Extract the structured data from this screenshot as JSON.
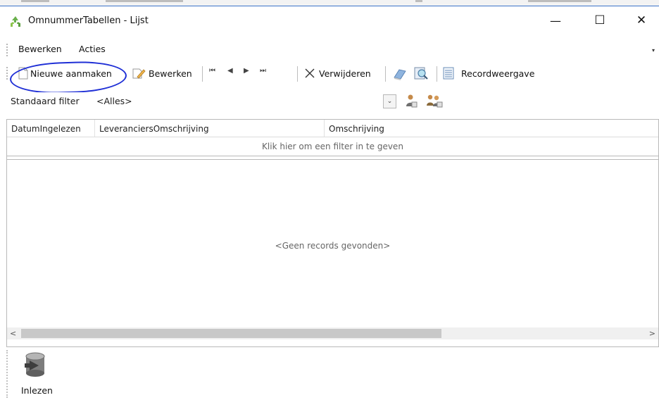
{
  "window": {
    "title": "OmnummerTabellen - Lijst",
    "minimize_glyph": "—",
    "maximize_glyph": "☐",
    "close_glyph": "✕"
  },
  "menu": {
    "items": [
      "Bewerken",
      "Acties"
    ],
    "overflow_glyph": "▾"
  },
  "toolbar": {
    "new_label": "Nieuwe aanmaken",
    "edit_label": "Bewerken",
    "nav": {
      "first": "⏮",
      "prev": "◀",
      "next": "▶",
      "last": "⏭"
    },
    "delete_label": "Verwijderen",
    "record_view_label": "Recordweergave"
  },
  "filter": {
    "label": "Standaard filter",
    "value": "<Alles>",
    "dropdown_glyph": "⌄"
  },
  "grid": {
    "columns": [
      "DatumIngelezen",
      "LeveranciersOmschrijving",
      "Omschrijving"
    ],
    "filter_hint": "Klik hier om een filter in te geven",
    "empty_text": "<Geen records gevonden>",
    "scroll_left": "<",
    "scroll_right": ">"
  },
  "bottom": {
    "read_label": "Inlezen"
  },
  "colors": {
    "annotation": "#1f2fd6",
    "window_border": "#3b74c8",
    "app_icon": "#6ab04c"
  },
  "icons": [
    "recycle-app-icon",
    "new-document-icon",
    "edit-pencil-icon",
    "delete-x-icon",
    "refresh-icon",
    "search-icon",
    "record-view-icon",
    "user-filter-icon",
    "users-filter-icon",
    "database-import-icon"
  ]
}
